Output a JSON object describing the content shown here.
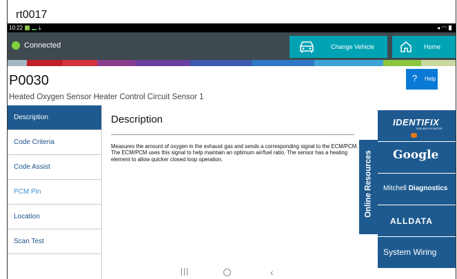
{
  "window": {
    "title": "rt0017"
  },
  "status_bar": {
    "time": "10:22"
  },
  "header": {
    "connection_status": "Connected",
    "change_vehicle_label": "Change Vehicle",
    "home_label": "Home",
    "help_label": "Help",
    "help_icon_glyph": "?"
  },
  "accent_colors": {
    "topbar": "#3e4a4f",
    "teal_button": "#00a3b4",
    "nav_blue": "#1e5a8f",
    "help_blue": "#0a7ad6",
    "connected_dot": "#7fd23d",
    "strip": [
      "#a4b6c2",
      "#c0202a",
      "#d3343e",
      "#8a3d8f",
      "#6b3fa0",
      "#3d5bb0",
      "#2e79c6",
      "#3fa3d8",
      "#8cc63f",
      "#c8d8a0"
    ]
  },
  "code": {
    "id": "P0030",
    "title": "Heated Oxygen Sensor Heater Control Circuit Sensor 1"
  },
  "sidebar": {
    "items": [
      {
        "label": "Description",
        "state": "active"
      },
      {
        "label": "Code Criteria"
      },
      {
        "label": "Code Assist"
      },
      {
        "label": "PCM Pin"
      },
      {
        "label": "Location"
      },
      {
        "label": "Scan Test"
      }
    ]
  },
  "content": {
    "heading": "Description",
    "body": "Measures the amount of oxygen in the exhaust gas and sends a corresponding signal to the ECM/PCM. The ECM/PCM uses this signal to help maintain an optimum air/fuel ratio. The sensor has a heating element to allow quicker closed loop operation."
  },
  "online_resources": {
    "tab_label": "Online Resources",
    "items": [
      {
        "name": "IDENTIFIX",
        "tagline": "FIND AND FIX FASTER"
      },
      {
        "name": "Google"
      },
      {
        "name_prefix": "Mitchell ",
        "name_bold": "Diagnostics"
      },
      {
        "name": "ALLDATA"
      },
      {
        "name": "System Wiring"
      }
    ]
  },
  "system_nav": {
    "recent": "recent-apps",
    "home": "home",
    "back": "back"
  }
}
